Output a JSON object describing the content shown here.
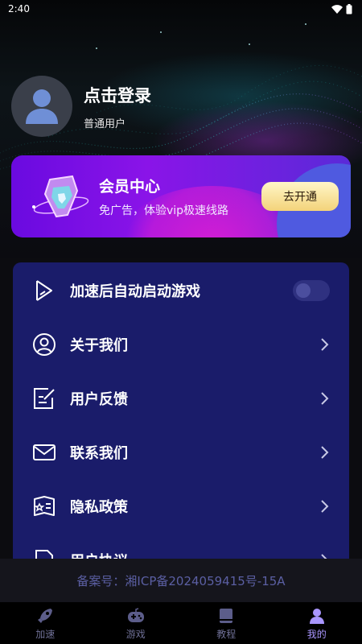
{
  "status_bar": {
    "time": "2:40"
  },
  "profile": {
    "login_text": "点击登录",
    "user_type": "普通用户"
  },
  "vip": {
    "title": "会员中心",
    "subtitle": "免广告，体验vip极速线路",
    "button_label": "去开通"
  },
  "menu": {
    "items": [
      {
        "label": "加速后自动启动游戏",
        "icon": "play-icon",
        "control": "toggle",
        "toggle_on": false
      },
      {
        "label": "关于我们",
        "icon": "user-circle-icon",
        "control": "chevron"
      },
      {
        "label": "用户反馈",
        "icon": "edit-note-icon",
        "control": "chevron"
      },
      {
        "label": "联系我们",
        "icon": "mail-icon",
        "control": "chevron"
      },
      {
        "label": "隐私政策",
        "icon": "policy-icon",
        "control": "chevron"
      },
      {
        "label": "用户协议",
        "icon": "document-icon",
        "control": "chevron"
      }
    ]
  },
  "footer": {
    "icp": "备案号：湘ICP备2024059415号-15A"
  },
  "bottom_nav": {
    "tabs": [
      {
        "label": "加速",
        "icon": "rocket-icon"
      },
      {
        "label": "游戏",
        "icon": "gamepad-icon"
      },
      {
        "label": "教程",
        "icon": "book-icon"
      },
      {
        "label": "我的",
        "icon": "profile-icon",
        "active": true
      }
    ]
  },
  "colors": {
    "menu_bg": "#1a1c6a",
    "vip_button": "#f3d37a",
    "active_tab": "#a996ff"
  }
}
